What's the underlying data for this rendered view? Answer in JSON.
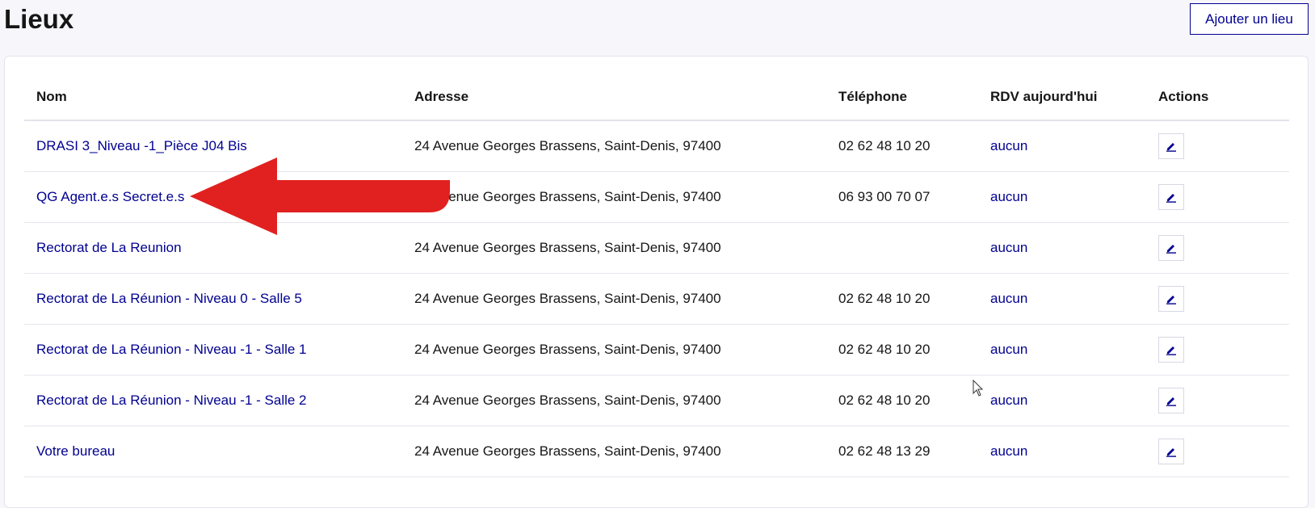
{
  "page": {
    "title": "Lieux",
    "add_button_label": "Ajouter un lieu"
  },
  "table": {
    "headers": {
      "name": "Nom",
      "address": "Adresse",
      "phone": "Téléphone",
      "rdv_today": "RDV aujourd'hui",
      "actions": "Actions"
    },
    "rows": [
      {
        "name": "DRASI 3_Niveau -1_Pièce J04 Bis",
        "address": "24 Avenue Georges Brassens, Saint-Denis, 97400",
        "phone": "02 62 48 10 20",
        "rdv": "aucun"
      },
      {
        "name": "QG Agent.e.s Secret.e.s",
        "address": "24 Avenue Georges Brassens, Saint-Denis, 97400",
        "phone": "06 93 00 70 07",
        "rdv": "aucun"
      },
      {
        "name": "Rectorat de La Reunion",
        "address": "24 Avenue Georges Brassens, Saint-Denis, 97400",
        "phone": "",
        "rdv": "aucun"
      },
      {
        "name": "Rectorat de La Réunion - Niveau 0 - Salle 5",
        "address": "24 Avenue Georges Brassens, Saint-Denis, 97400",
        "phone": "02 62 48 10 20",
        "rdv": "aucun"
      },
      {
        "name": "Rectorat de La Réunion - Niveau -1 - Salle 1",
        "address": "24 Avenue Georges Brassens, Saint-Denis, 97400",
        "phone": "02 62 48 10 20",
        "rdv": "aucun"
      },
      {
        "name": "Rectorat de La Réunion - Niveau -1 - Salle 2",
        "address": "24 Avenue Georges Brassens, Saint-Denis, 97400",
        "phone": "02 62 48 10 20",
        "rdv": "aucun"
      },
      {
        "name": "Votre bureau",
        "address": "24 Avenue Georges Brassens, Saint-Denis, 97400",
        "phone": "02 62 48 13 29",
        "rdv": "aucun"
      }
    ]
  },
  "icons": {
    "edit": "pencil-icon",
    "annotation": "red-arrow-icon",
    "cursor": "mouse-cursor-icon"
  },
  "colors": {
    "link": "#000091",
    "arrow": "#e1211f",
    "background": "#f6f6fb"
  }
}
